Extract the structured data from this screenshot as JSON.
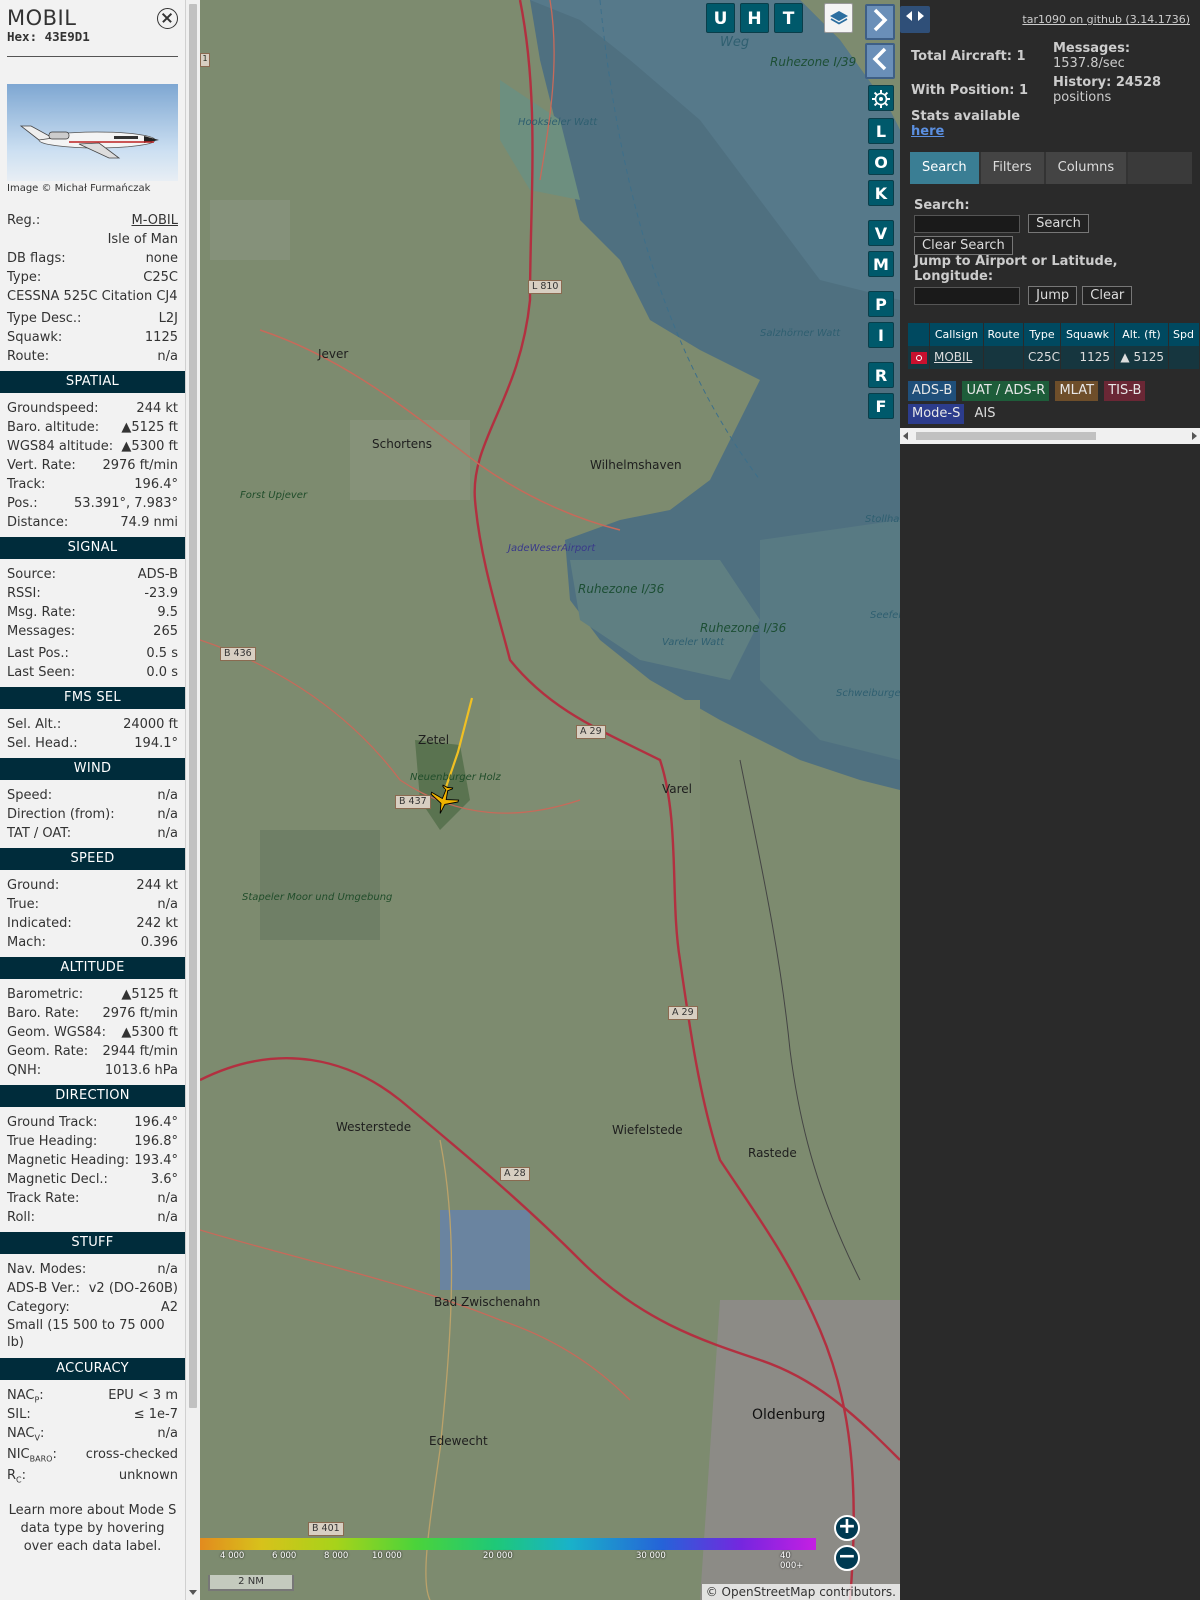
{
  "infoblock": {
    "callsign": "MOBIL",
    "hex": "Hex:  43E9D1",
    "photo_credit": "Image © Michał Furmańczak",
    "registration": {
      "label": "Reg.:",
      "value": "M-OBIL",
      "country": "Isle of Man"
    },
    "rows1": [
      {
        "label": "DB flags:",
        "value": "none"
      },
      {
        "label": "Type:",
        "value": "C25C"
      }
    ],
    "type_full": "CESSNA 525C Citation CJ4",
    "rows2": [
      {
        "label": "Type Desc.:",
        "value": "L2J"
      },
      {
        "label": "Squawk:",
        "value": "1125"
      },
      {
        "label": "Route:",
        "value": "n/a"
      }
    ],
    "spatial": {
      "title": "SPATIAL",
      "rows": [
        {
          "label": "Groundspeed:",
          "value": "244 kt"
        },
        {
          "label": "Baro. altitude:",
          "value": "▲5125 ft"
        },
        {
          "label": "WGS84 altitude:",
          "value": "▲5300 ft"
        },
        {
          "label": "Vert. Rate:",
          "value": "2976 ft/min"
        },
        {
          "label": "Track:",
          "value": "196.4°"
        },
        {
          "label": "Pos.:",
          "value": "53.391°, 7.983°"
        },
        {
          "label": "Distance:",
          "value": "74.9 nmi"
        }
      ]
    },
    "signal": {
      "title": "SIGNAL",
      "rows": [
        {
          "label": "Source:",
          "value": "ADS-B"
        },
        {
          "label": "RSSI:",
          "value": "-23.9"
        },
        {
          "label": "Msg. Rate:",
          "value": "9.5"
        },
        {
          "label": "Messages:",
          "value": "265"
        }
      ],
      "rows_b": [
        {
          "label": "Last Pos.:",
          "value": "0.5 s"
        },
        {
          "label": "Last Seen:",
          "value": "0.0 s"
        }
      ]
    },
    "fms": {
      "title": "FMS SEL",
      "rows": [
        {
          "label": "Sel. Alt.:",
          "value": "24000 ft"
        },
        {
          "label": "Sel. Head.:",
          "value": "194.1°"
        }
      ]
    },
    "wind": {
      "title": "WIND",
      "rows": [
        {
          "label": "Speed:",
          "value": "n/a"
        },
        {
          "label": "Direction (from):",
          "value": "n/a"
        },
        {
          "label": "TAT / OAT:",
          "value": "n/a"
        }
      ]
    },
    "speed": {
      "title": "SPEED",
      "rows": [
        {
          "label": "Ground:",
          "value": "244 kt"
        },
        {
          "label": "True:",
          "value": "n/a"
        },
        {
          "label": "Indicated:",
          "value": "242 kt"
        },
        {
          "label": "Mach:",
          "value": "0.396"
        }
      ]
    },
    "altitude": {
      "title": "ALTITUDE",
      "rows": [
        {
          "label": "Barometric:",
          "value": "▲5125 ft"
        },
        {
          "label": "Baro. Rate:",
          "value": "2976 ft/min"
        },
        {
          "label": "Geom. WGS84:",
          "value": "▲5300 ft"
        },
        {
          "label": "Geom. Rate:",
          "value": "2944 ft/min"
        },
        {
          "label": "QNH:",
          "value": "1013.6 hPa"
        }
      ]
    },
    "direction": {
      "title": "DIRECTION",
      "rows": [
        {
          "label": "Ground Track:",
          "value": "196.4°"
        },
        {
          "label": "True Heading:",
          "value": "196.8°"
        },
        {
          "label": "Magnetic Heading:",
          "value": "193.4°"
        },
        {
          "label": "Magnetic Decl.:",
          "value": "3.6°"
        },
        {
          "label": "Track Rate:",
          "value": "n/a"
        },
        {
          "label": "Roll:",
          "value": "n/a"
        }
      ]
    },
    "stuff": {
      "title": "STUFF",
      "rows": [
        {
          "label": "Nav. Modes:",
          "value": "n/a"
        },
        {
          "label": "ADS-B Ver.:",
          "value": "v2 (DO-260B)"
        },
        {
          "label": "Category:",
          "value": "A2"
        }
      ],
      "category_desc": "Small (15 500 to 75 000 lb)"
    },
    "accuracy": {
      "title": "ACCURACY",
      "nacp": {
        "label": "NAC",
        "sub": "P",
        "value": "EPU < 3 m"
      },
      "sil": {
        "label": "SIL:",
        "value": "≤ 1e-7"
      },
      "nacv": {
        "label": "NAC",
        "sub": "V",
        "value": "n/a"
      },
      "nicbaro": {
        "label": "NIC",
        "sub": "BARO",
        "value": "cross-checked"
      },
      "rc": {
        "label": "R",
        "sub": "C",
        "value": "unknown"
      }
    },
    "learn_more": "Learn more about Mode S data type by hovering over each data label."
  },
  "map": {
    "buttons": [
      "U",
      "H",
      "T"
    ],
    "side_buttons": [
      "L",
      "O",
      "K",
      "V",
      "M",
      "P",
      "I",
      "R",
      "F"
    ],
    "labels": {
      "weg": "Weg",
      "ruhezone139": "Ruhezone I/39",
      "hooksieler": "Hooksieler Watt",
      "l810": "L 810",
      "salzhorner": "Salzhörner Watt",
      "jever": "Jever",
      "schortens": "Schortens",
      "wilhelmshaven": "Wilhelmshaven",
      "forst": "Forst Upjever",
      "jadeweser": "JadeWeserAirport",
      "stollham": "Stollham Watt",
      "ruhezone136a": "Ruhezone I/36",
      "ruhezone136b": "Ruhezone I/36",
      "vareler": "Vareler Watt",
      "seefeld": "Seefelder Watt",
      "schweiburg": "Schweiburger Watt",
      "b436": "B 436",
      "a29a": "A 29",
      "zetel": "Zetel",
      "neuenburger": "Neuenburger Holz",
      "b437": "B 437",
      "varel": "Varel",
      "stapeler": "Stapeler Moor und Umgebung",
      "a29b": "A 29",
      "westerstede": "Westerstede",
      "wiefelstede": "Wiefelstede",
      "rastede": "Rastede",
      "a28": "A 28",
      "badzw": "Bad Zwischenahn",
      "oldenburg": "Oldenburg",
      "edewecht": "Edewecht",
      "b401": "B 401",
      "one": "1"
    },
    "colorbar_ticks": [
      "4 000",
      "6 000",
      "8 000",
      "10 000",
      "20 000",
      "30 000",
      "40 000+"
    ],
    "scale": "2 NM",
    "attribution": "© OpenStreetMap contributors."
  },
  "sidebar": {
    "github": "tar1090 on github (3.14.1736)",
    "total_aircraft": "Total Aircraft: 1",
    "with_position": "With Position: 1",
    "messages_label": "Messages:",
    "messages_value": "1537.8/sec",
    "history_label": "History: 24528",
    "history_value": "positions",
    "stats_label": "Stats available",
    "stats_link": "here",
    "tabs": [
      "Search",
      "Filters",
      "Columns"
    ],
    "search_label": "Search:",
    "search_button": "Search",
    "clear_search": "Clear Search",
    "jump_label": "Jump to Airport or Latitude, Longitude:",
    "jump_button": "Jump",
    "clear_button": "Clear",
    "table_headers": [
      "Callsign",
      "Route",
      "Type",
      "Squawk",
      "Alt. (ft)",
      "Spd"
    ],
    "table_row": {
      "callsign": "MOBIL",
      "route": "",
      "type": "C25C",
      "squawk": "1125",
      "alt": "▲ 5125"
    },
    "sources": [
      "ADS-B",
      "UAT / ADS-R",
      "MLAT",
      "TIS-B",
      "Mode-S",
      "AIS"
    ],
    "source_colors": [
      "#1f4f7a",
      "#1e5d3a",
      "#6e4e2a",
      "#6a2735",
      "#2c3c8c",
      "#2a2a2a"
    ]
  }
}
